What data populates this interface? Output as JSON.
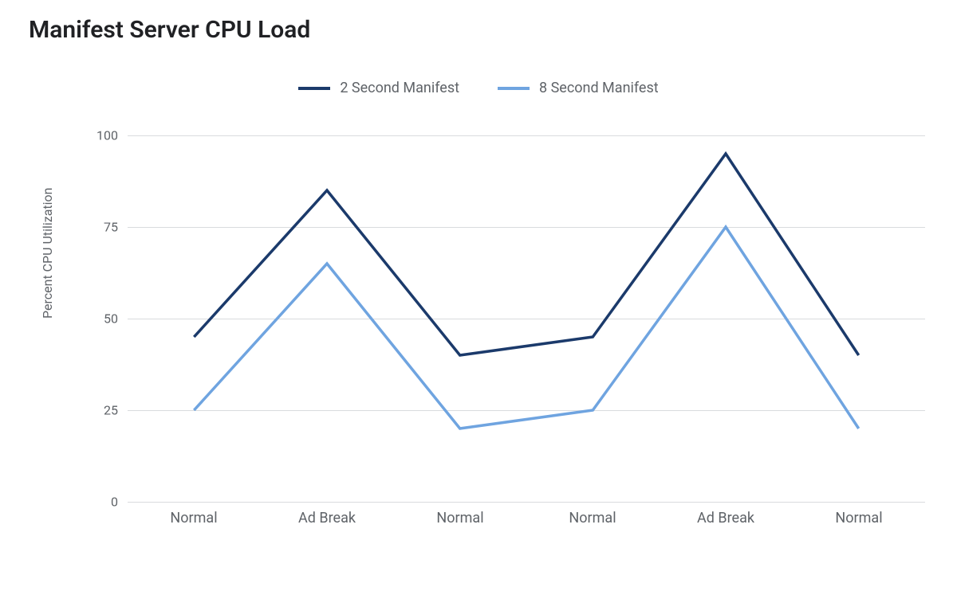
{
  "title": "Manifest Server CPU Load",
  "ylabel": "Percent CPU Utilization",
  "legend": {
    "s0": "2 Second Manifest",
    "s1": "8 Second Manifest"
  },
  "yticks": [
    "0",
    "25",
    "50",
    "75",
    "100"
  ],
  "xticks": [
    "Normal",
    "Ad Break",
    "Normal",
    "Normal",
    "Ad Break",
    "Normal"
  ],
  "chart_data": {
    "type": "line",
    "title": "Manifest Server CPU Load",
    "xlabel": "",
    "ylabel": "Percent CPU Utilization",
    "ylim": [
      0,
      100
    ],
    "categories": [
      "Normal",
      "Ad Break",
      "Normal",
      "Normal",
      "Ad Break",
      "Normal"
    ],
    "series": [
      {
        "name": "2 Second Manifest",
        "values": [
          45,
          85,
          40,
          45,
          95,
          40
        ]
      },
      {
        "name": "8 Second Manifest",
        "values": [
          25,
          65,
          20,
          25,
          75,
          20
        ]
      }
    ],
    "legend_position": "top",
    "grid": true
  }
}
